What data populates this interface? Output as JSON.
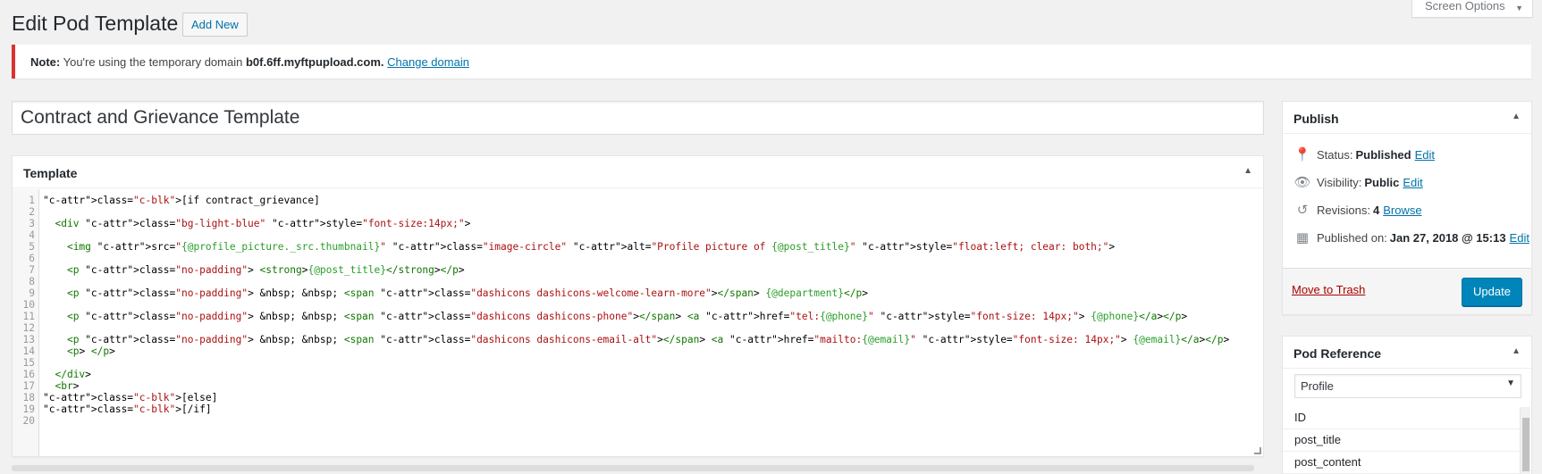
{
  "header": {
    "title": "Edit Pod Template",
    "add_new": "Add New",
    "screen_options": "Screen Options"
  },
  "notice": {
    "label": "Note:",
    "text": "You're using the temporary domain",
    "domain": "b0f.6ff.myftpupload.com.",
    "link": "Change domain"
  },
  "post_title": "Contract and Grievance Template",
  "template_box": {
    "title": "Template",
    "lines": [
      "[if contract_grievance]",
      "",
      "  <div class=\"bg-light-blue\" style=\"font-size:14px;\">",
      "",
      "    <img src=\"{@profile_picture._src.thumbnail}\" class=\"image-circle\" alt=\"Profile picture of {@post_title}\" style=\"float:left; clear: both;\">",
      "",
      "    <p class=\"no-padding\"> <strong>{@post_title}</strong></p>",
      "",
      "    <p class=\"no-padding\"> &nbsp; &nbsp; <span class=\"dashicons dashicons-welcome-learn-more\"></span> {@department}</p>",
      "",
      "    <p class=\"no-padding\"> &nbsp; &nbsp; <span class=\"dashicons dashicons-phone\"></span> <a href=\"tel:{@phone}\" style=\"font-size: 14px;\"> {@phone}</a></p>",
      "",
      "    <p class=\"no-padding\"> &nbsp; &nbsp; <span class=\"dashicons dashicons-email-alt\"></span> <a href=\"mailto:{@email}\" style=\"font-size: 14px;\"> {@email}</a></p>",
      "    <p> </p>",
      "",
      "  </div>",
      "  <br>",
      "[else]",
      "[/if]",
      ""
    ]
  },
  "publish": {
    "title": "Publish",
    "status_label": "Status:",
    "status_value": "Published",
    "visibility_label": "Visibility:",
    "visibility_value": "Public",
    "revisions_label": "Revisions:",
    "revisions_value": "4",
    "revisions_link": "Browse",
    "published_label": "Published on:",
    "published_value": "Jan 27, 2018 @ 15:13",
    "edit": "Edit",
    "trash": "Move to Trash",
    "update": "Update"
  },
  "pod_reference": {
    "title": "Pod Reference",
    "selected": "Profile",
    "fields": [
      "ID",
      "post_title",
      "post_content"
    ]
  },
  "colors": {
    "accent": "#0085ba",
    "notice_border": "#dc3232",
    "link": "#0073aa",
    "trash": "#aa0000"
  }
}
